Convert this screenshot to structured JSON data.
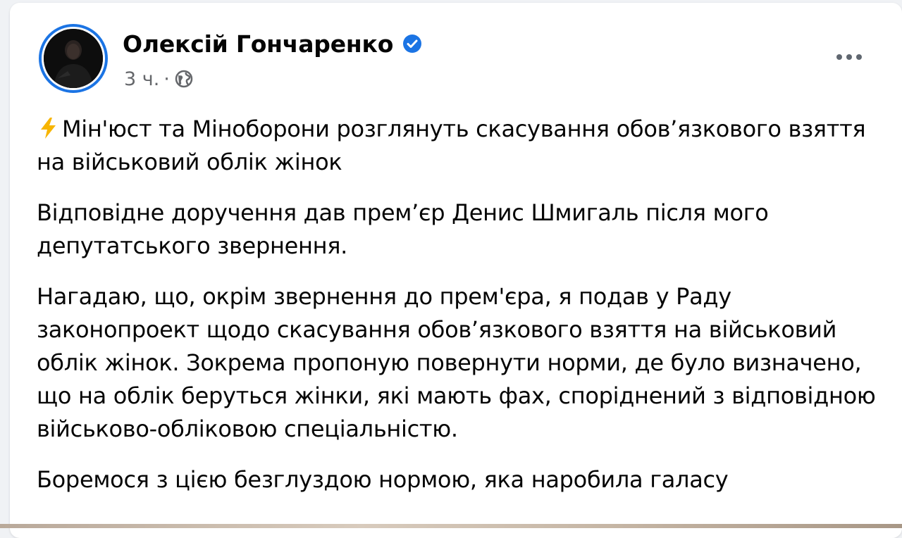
{
  "post": {
    "author": {
      "name": "Олексій Гончаренко",
      "verified_icon": "verified-badge-icon",
      "avatar_icon": "profile-photo"
    },
    "meta": {
      "time": "3 ч.",
      "separator": "·",
      "audience_icon": "globe-icon"
    },
    "more_icon": "more-options-icon",
    "headline_icon": "lightning-bolt-emoji",
    "headline": "Мін'юст та Міноборони розглянуть скасування обовʼязкового взяття на військовий облік жінок",
    "paragraphs": [
      "Відповідне доручення дав премʼєр Денис Шмигаль після мого депутатського звернення.",
      "Нагадаю, що, окрім звернення до прем'єра, я подав у Раду законопроект щодо скасування обовʼязкового взяття на військовий облік жінок. Зокрема пропоную повернути норми, де було визначено, що на облік беруться жінки, які мають фах, споріднений з відповідною військово-обліковою спеціальністю.",
      "Боремося з цією безглуздою нормою, яка наробила галасу"
    ]
  },
  "colors": {
    "accent": "#1b74e4",
    "text": "#050505",
    "secondary_text": "#65676b",
    "bolt": "#f7b500"
  }
}
